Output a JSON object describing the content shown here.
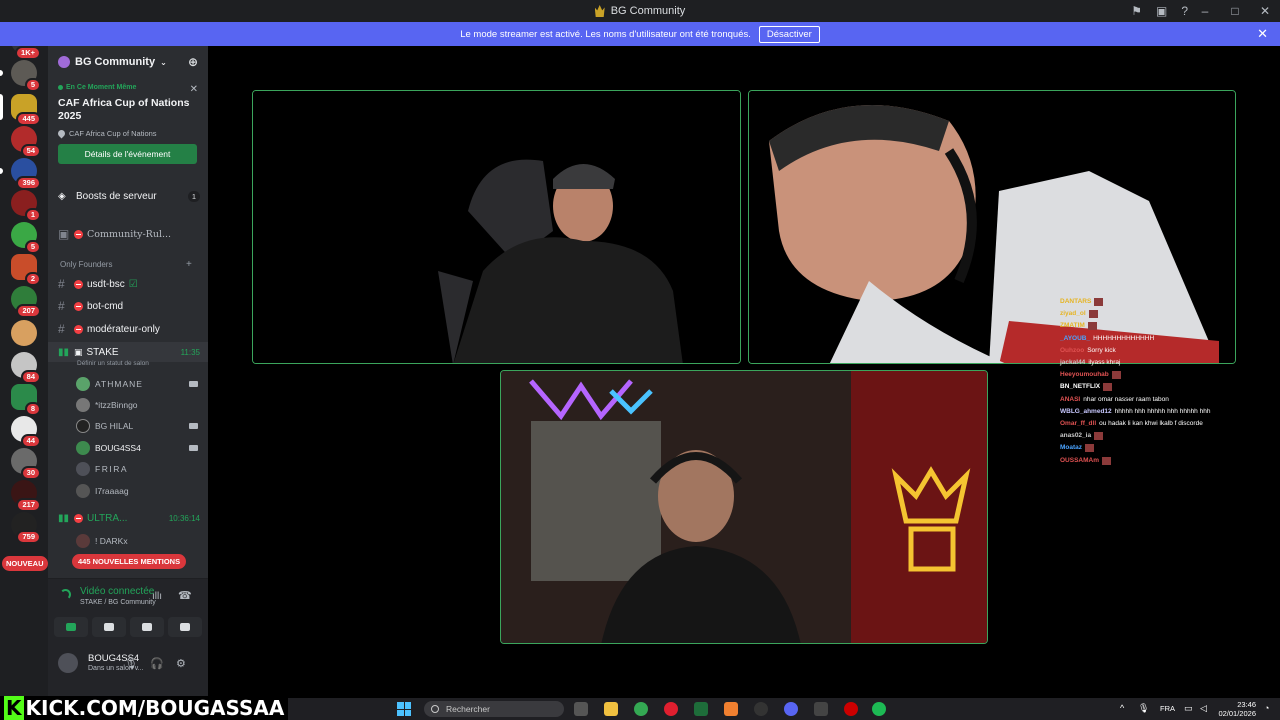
{
  "window": {
    "title": "BG Community"
  },
  "banner": {
    "text": "Le mode streamer est activé. Les noms d'utilisateur ont été tronqués.",
    "button": "Désactiver"
  },
  "rail": {
    "badges": [
      "1K+",
      "5",
      "445",
      "54",
      "396",
      "1",
      "5",
      "2",
      "207",
      "84",
      "8",
      "44",
      "30",
      "217",
      "759"
    ],
    "new_label": "NOUVEAU"
  },
  "guild": {
    "name": "BG Community"
  },
  "event": {
    "live_label": "En Ce Moment Même",
    "title": "CAF Africa Cup of Nations 2025",
    "location": "CAF Africa Cup of Nations",
    "button": "Détails de l'événement"
  },
  "channels": {
    "boosts": {
      "label": "Boosts de serveur",
      "count": "1"
    },
    "rules": "Community-Rul...",
    "category": "Only Founders",
    "usdt": "usdt-bsc",
    "botcmd": "bot-cmd",
    "moderateur": "modérateur-only",
    "stake": {
      "name": "STAKE",
      "time": "11:35",
      "status": "Définir un statut de salon"
    },
    "ultra": {
      "name": "ULTRA...",
      "time": "10:36:14"
    }
  },
  "voice_users": [
    "ATHMANE",
    "*itzzBinngo",
    "BG HILAL",
    "BOUG4SS4",
    "FRIRA",
    "I7raaaag",
    "! DARKx"
  ],
  "mentions": "445 NOUVELLES MENTIONS",
  "voice_panel": {
    "status": "Vidéo connectée",
    "channel": "STAKE / BG Community"
  },
  "user_panel": {
    "name": "BOUG4SS4",
    "status": "Dans un salon v..."
  },
  "chat": [
    {
      "user": "DANTARS",
      "msg": "",
      "color": "#e6b422"
    },
    {
      "user": "ziyad_ol",
      "msg": "",
      "color": "#e6b422"
    },
    {
      "user": "ZMATIM",
      "msg": "",
      "color": "#e6b422"
    },
    {
      "user": "_AYOUB_",
      "msg": "HHHHHHHHHHHHH",
      "color": "#4aa3ff"
    },
    {
      "user": "Ouhzoo",
      "msg": "Sorry kick",
      "color": "#e05252"
    },
    {
      "user": "jackal44",
      "msg": "ilyass khraj",
      "color": "#c8c8c8"
    },
    {
      "user": "Heeyoumouhab",
      "msg": "",
      "color": "#e05252"
    },
    {
      "user": "BN_NETFLIX",
      "msg": "",
      "color": "#ffffff"
    },
    {
      "user": "ANASI",
      "msg": "nhar omar nasser raam tabon",
      "color": "#e05252"
    },
    {
      "user": "WBLG_ahmed12",
      "msg": "hhhhh hhh hhhhh hhh hhhhh hhh",
      "color": "#c8c8ff"
    },
    {
      "user": "Omar_ff_dll",
      "msg": "ou hadak li kan khwi lkalb f discorde",
      "color": "#e05252"
    },
    {
      "user": "anas02_ia",
      "msg": "",
      "color": "#c8c8c8"
    },
    {
      "user": "Moataz",
      "msg": "",
      "color": "#4aa3ff"
    },
    {
      "user": "OUSSAMAm",
      "msg": "",
      "color": "#e05252"
    }
  ],
  "taskbar": {
    "kick": "KICK.COM/BOUGASSAA",
    "search": "Rechercher",
    "lang": "FRA",
    "time": "23:46",
    "date": "02/01/2026"
  }
}
